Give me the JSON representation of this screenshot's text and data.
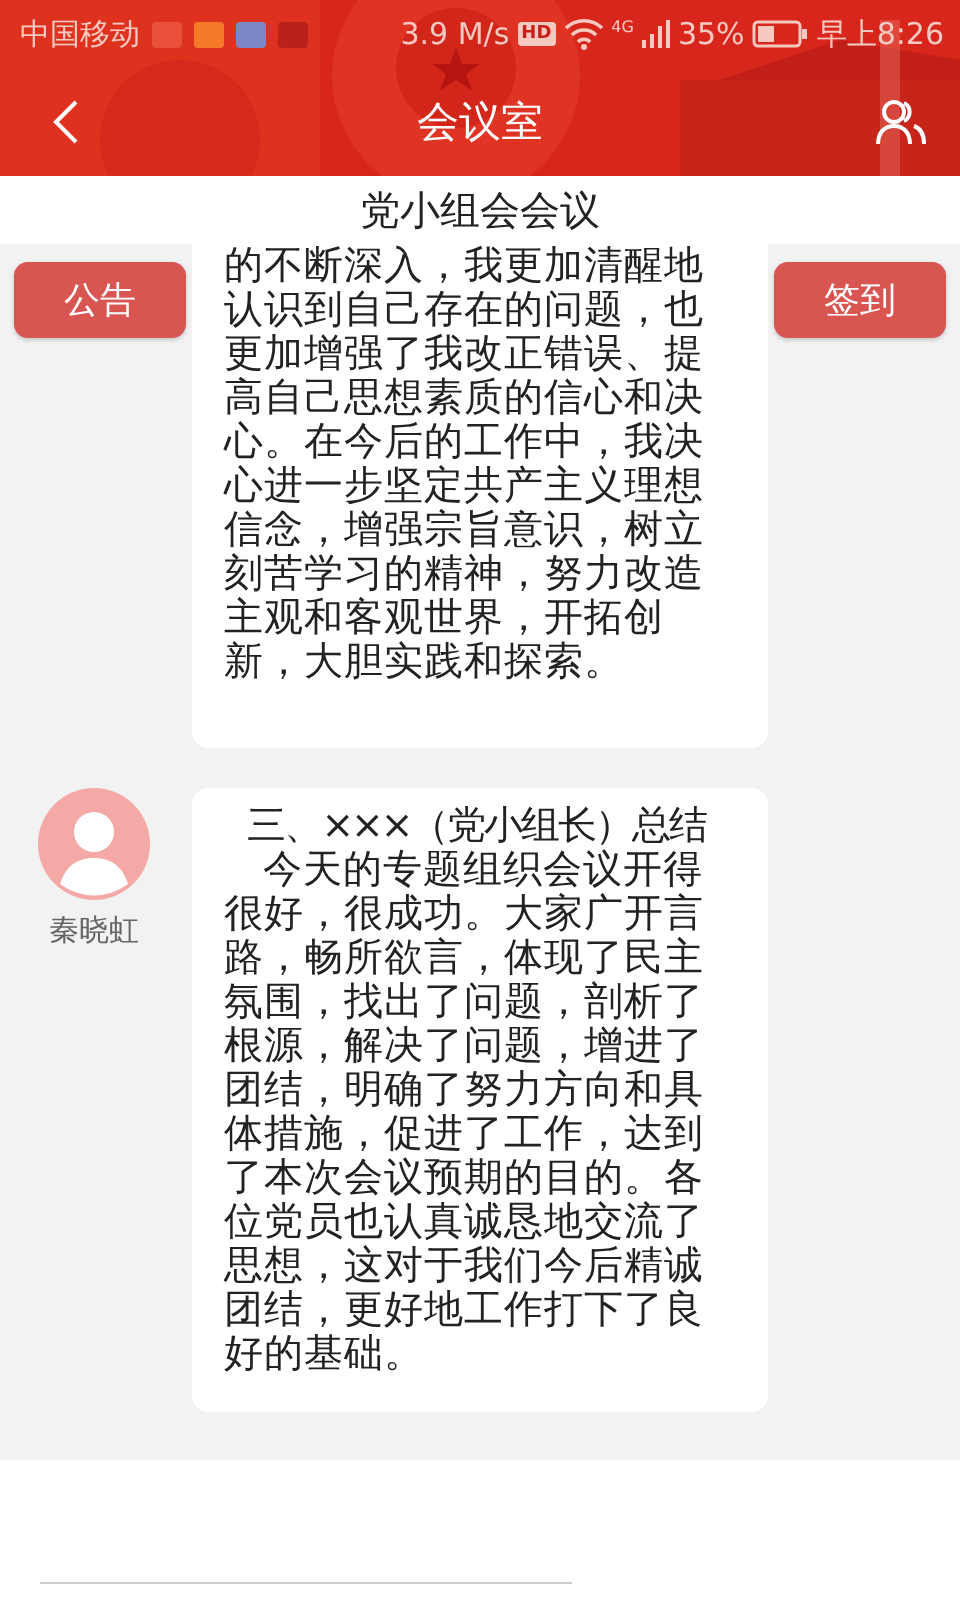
{
  "status_bar": {
    "carrier": "中国移动",
    "speed": "3.9 M/s",
    "hd": "HD",
    "network": "4G",
    "battery": "35%",
    "time": "早上8:26"
  },
  "header": {
    "title": "会议室"
  },
  "meeting_title": "党小组会会议",
  "left_button": "公告",
  "right_button": "签到",
  "messages": [
    {
      "paragraphs": [
        "的不断深入，我更加清醒地认识到自己存在的问题，也更加增强了我改正错误、提高自己思想素质的信心和决心。在今后的工作中，我决心进一步坚定共产主义理想信念，增强宗旨意识，树立刻苦学习的精神，努力改造主观和客观世界，开拓创新，大胆实践和探索。"
      ]
    },
    {
      "sender": "秦晓虹",
      "paragraphs": [
        "三、×××（党小组长）总结",
        "今天的专题组织会议开得很好，很成功。大家广开言路，畅所欲言，体现了民主氛围，找出了问题，剖析了根源，解决了问题，增进了团结，明确了努力方向和具体措施，促进了工作，达到了本次会议预期的目的。各位党员也认真诚恳地交流了思想，这对于我们今后精诚团结，更好地工作打下了良好的基础。"
      ]
    }
  ]
}
